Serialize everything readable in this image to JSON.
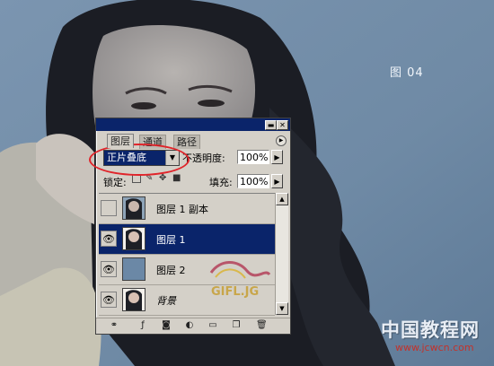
{
  "figure_label": "图 04",
  "watermark": {
    "site_name": "中国教程网",
    "url": "www.jcwcn.com"
  },
  "stamp_text": "GIFL.JG",
  "palette": {
    "tabs": [
      {
        "label": "图层",
        "active": true
      },
      {
        "label": "通道",
        "active": false
      },
      {
        "label": "路径",
        "active": false
      }
    ],
    "blend_mode": "正片叠底",
    "opacity_label": "不透明度:",
    "opacity_value": "100%",
    "lock_label": "锁定:",
    "fill_label": "填充:",
    "fill_value": "100%",
    "layers": [
      {
        "name": "图层 1 副本",
        "visible": false,
        "selected": false,
        "thumb": "photo"
      },
      {
        "name": "图层 1",
        "visible": true,
        "selected": true,
        "thumb": "photo"
      },
      {
        "name": "图层 2",
        "visible": true,
        "selected": false,
        "thumb": "blue-fill"
      },
      {
        "name": "背景",
        "visible": true,
        "selected": false,
        "thumb": "photo",
        "italic": true
      }
    ],
    "bottom_icons": [
      "link-icon",
      "layer-style-icon",
      "mask-icon",
      "adjustment-icon",
      "new-group-icon",
      "new-layer-icon",
      "delete-icon"
    ]
  },
  "colors": {
    "accent_blue": "#0a246a",
    "panel_gray": "#d4d0c8",
    "annotation_red": "#e0242a",
    "layer2_fill": "#6b88a6",
    "background_blue": "#6f8aa5"
  }
}
